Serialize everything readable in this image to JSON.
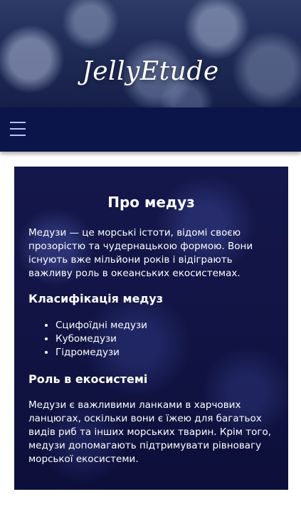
{
  "header": {
    "site_title": "JellyEtude"
  },
  "nav": {
    "menu_icon": "hamburger-menu-icon",
    "colors": {
      "background": "#0b154a",
      "icon": "#b9c2ff"
    }
  },
  "article": {
    "title": "Про медуз",
    "intro": "Медузи — це морські істоти, відомі своєю прозорістю та чудернацькою формою. Вони існують вже мільйони років і відіграють важливу роль в океанських екосистемах.",
    "classification": {
      "heading": "Класифікація медуз",
      "items": [
        "Сцифоїдні медузи",
        "Кубомедузи",
        "Гідромедузи"
      ]
    },
    "ecosystem": {
      "heading": "Роль в екосистемі",
      "text": "Медузи є важливими ланками в харчових ланцюгах, оскільки вони є їжею для багатьох видів риб та інших морських тварин. Крім того, медузи допомагають підтримувати рівновагу морської екосистеми."
    }
  }
}
